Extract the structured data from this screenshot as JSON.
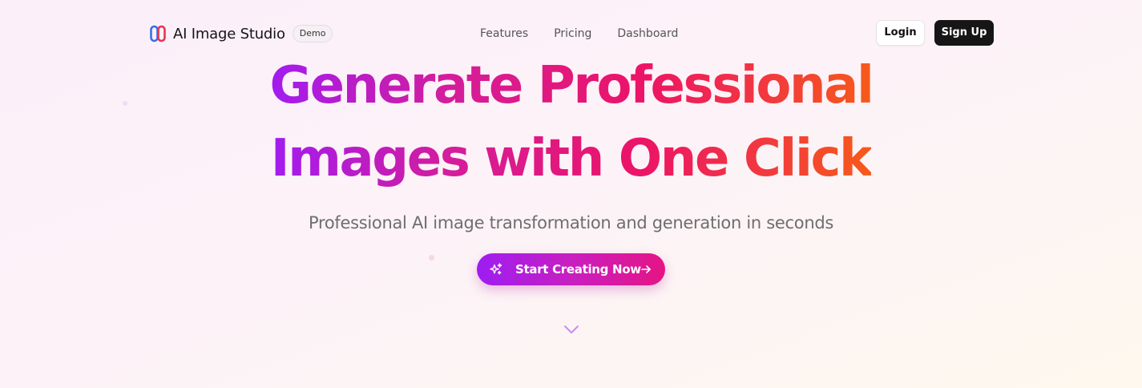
{
  "nav": {
    "brand_name": "AI Image Studio",
    "badge": "Demo",
    "links": [
      "Features",
      "Pricing",
      "Dashboard"
    ],
    "login_label": "Login",
    "signup_label": "Sign Up"
  },
  "hero": {
    "headline_line1": "Generate Professional",
    "headline_line2": "Images with One Click",
    "subtitle": "Professional AI image transformation and generation in seconds",
    "cta_label": "Start Creating Now"
  },
  "icons": {
    "logo": "brand-logo-icon",
    "cta_left": "sparkles-icon",
    "cta_right": "arrow-right-icon",
    "scroll": "chevron-down-icon"
  },
  "colors": {
    "gradient_start": "#a21cf0",
    "gradient_mid": "#ec1466",
    "gradient_end": "#f65a1a",
    "signup_bg": "#161616"
  }
}
